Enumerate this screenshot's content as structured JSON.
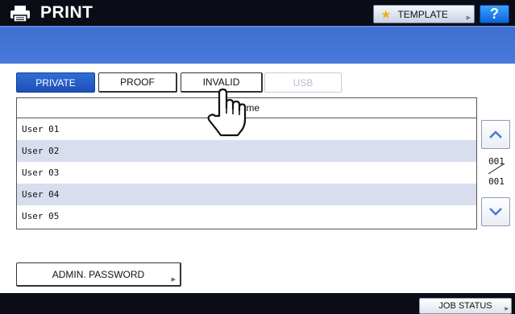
{
  "header": {
    "title": "PRINT",
    "template_label": "TEMPLATE",
    "help_label": "?"
  },
  "tabs": [
    {
      "label": "PRIVATE",
      "state": "selected"
    },
    {
      "label": "PROOF",
      "state": "normal"
    },
    {
      "label": "INVALID",
      "state": "normal"
    },
    {
      "label": "USB",
      "state": "disabled"
    }
  ],
  "table": {
    "column_header": "Name",
    "rows": [
      "User 01",
      "User 02",
      "User 03",
      "User 04",
      "User 05"
    ]
  },
  "pagination": {
    "current": "001",
    "total": "001"
  },
  "admin_password_label": "ADMIN. PASSWORD",
  "job_status_label": "JOB STATUS",
  "icons": {
    "title": "printer-icon",
    "template": "star-icon",
    "scroll_up": "chevron-up-icon",
    "scroll_down": "chevron-down-icon",
    "cursor": "hand-pointer-icon"
  },
  "colors": {
    "title_bar": "#0a0c16",
    "band": "#4473d6",
    "selected_tab": "#2360c8",
    "alt_row": "#d8deee",
    "help_button": "#1a7af0"
  }
}
